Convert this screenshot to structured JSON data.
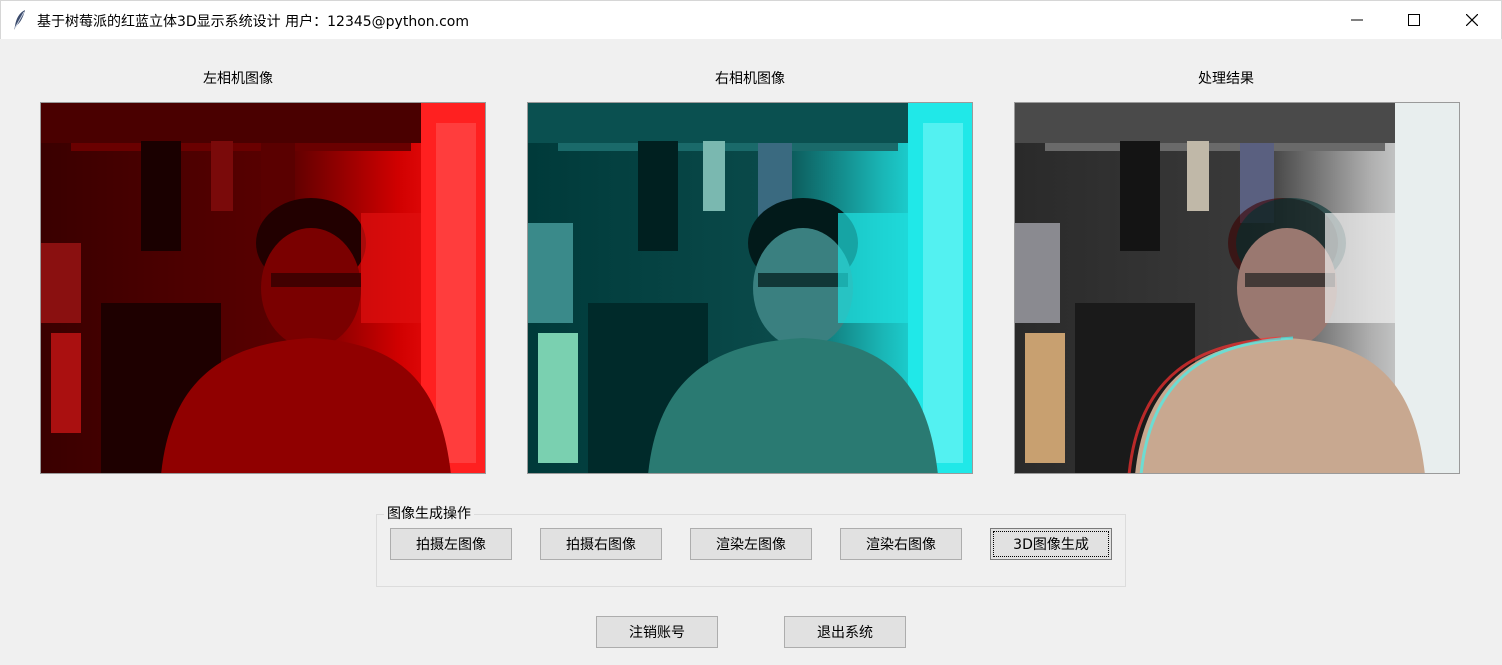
{
  "window": {
    "title": "基于树莓派的红蓝立体3D显示系统设计  用户：12345@python.com",
    "minimize_glyph": "—",
    "maximize_glyph": "☐",
    "close_glyph": "✕"
  },
  "panels": {
    "left_label": "左相机图像",
    "right_label": "右相机图像",
    "result_label": "处理结果"
  },
  "operations": {
    "group_title": "图像生成操作",
    "capture_left": "拍摄左图像",
    "capture_right": "拍摄右图像",
    "render_left": "渲染左图像",
    "render_right": "渲染右图像",
    "generate_3d": "3D图像生成"
  },
  "account": {
    "logout": "注销账号",
    "exit": "退出系统"
  },
  "colors": {
    "left_tint": "#c80000",
    "right_tint": "#00c8c8"
  },
  "icons": {
    "app": "feather-icon",
    "minimize": "minimize-icon",
    "maximize": "maximize-icon",
    "close": "close-icon"
  }
}
